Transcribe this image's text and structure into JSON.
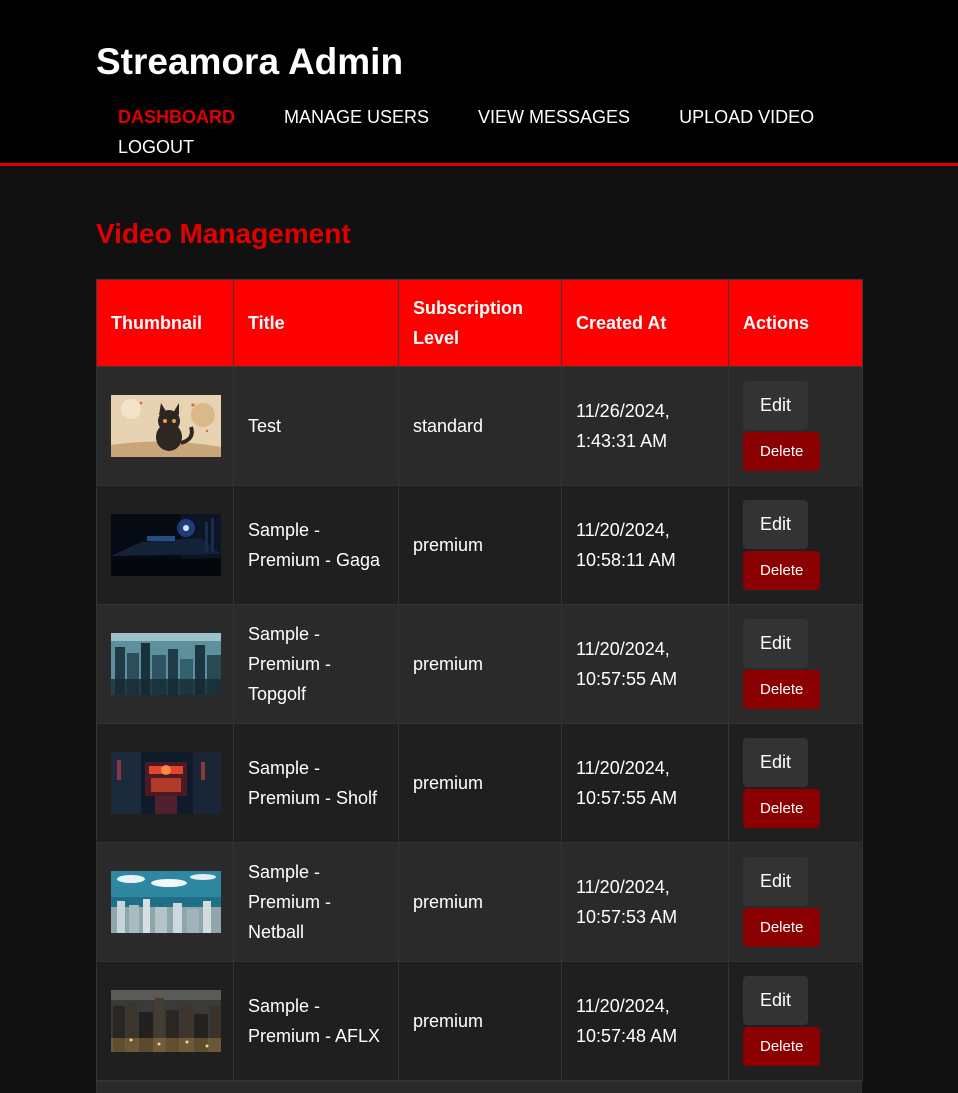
{
  "header": {
    "title": "Streamora Admin",
    "nav": [
      "DASHBOARD",
      "MANAGE USERS",
      "VIEW MESSAGES",
      "UPLOAD VIDEO",
      "LOGOUT"
    ],
    "active_nav": "DASHBOARD"
  },
  "main": {
    "title": "Video Management",
    "columns": [
      "Thumbnail",
      "Title",
      "Subscription Level",
      "Created At",
      "Actions"
    ],
    "edit_label": "Edit",
    "delete_label": "Delete",
    "rows": [
      {
        "title": "Test",
        "level": "standard",
        "created": "11/26/2024, 1:43:31 AM",
        "thumb": "cat"
      },
      {
        "title": "Sample - Premium - Gaga",
        "level": "premium",
        "created": "11/20/2024, 10:58:11 AM",
        "thumb": "night"
      },
      {
        "title": "Sample - Premium - Topgolf",
        "level": "premium",
        "created": "11/20/2024, 10:57:55 AM",
        "thumb": "city-teal"
      },
      {
        "title": "Sample - Premium - Sholf",
        "level": "premium",
        "created": "11/20/2024, 10:57:55 AM",
        "thumb": "neon"
      },
      {
        "title": "Sample - Premium - Netball",
        "level": "premium",
        "created": "11/20/2024, 10:57:53 AM",
        "thumb": "sky"
      },
      {
        "title": "Sample - Premium - AFLX",
        "level": "premium",
        "created": "11/20/2024, 10:57:48 AM",
        "thumb": "city-night"
      }
    ]
  },
  "colors": {
    "accent": "#ff0000",
    "header_bg": "#000000",
    "page_bg": "#111111",
    "delete_bg": "#8b0000",
    "edit_bg": "#333333"
  }
}
